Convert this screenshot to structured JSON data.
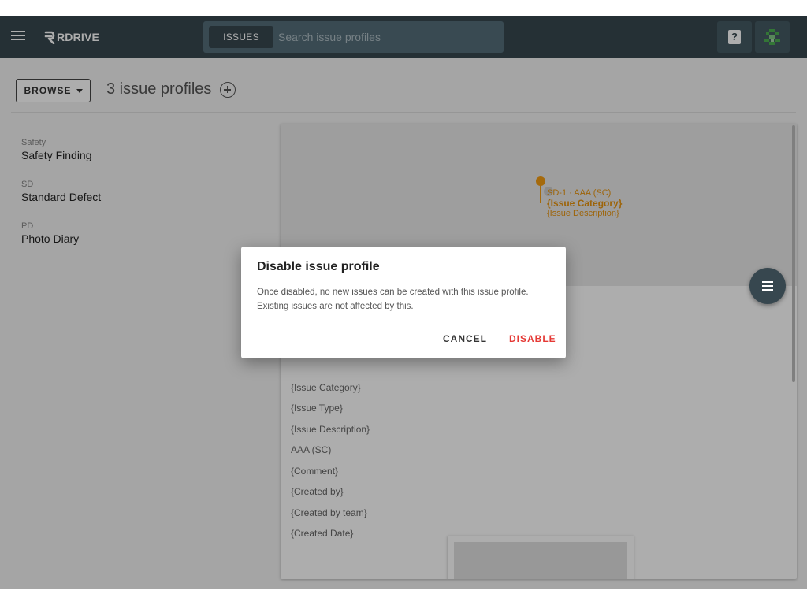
{
  "app": {
    "brand": "RDRIVE",
    "search_scope": "ISSUES",
    "search_placeholder": "Search issue profiles",
    "help_label": "?"
  },
  "header": {
    "browse_label": "BROWSE",
    "title": "3 issue profiles"
  },
  "profiles": [
    {
      "code": "Safety",
      "name": "Safety Finding"
    },
    {
      "code": "SD",
      "name": "Standard Defect"
    },
    {
      "code": "PD",
      "name": "Photo Diary"
    }
  ],
  "preview": {
    "pin_line1": "SD-1 · AAA (SC)",
    "pin_line2": "{Issue Category}",
    "pin_line3": "{Issue Description}",
    "fields": [
      "{Issue Category}",
      "{Issue Type}",
      "{Issue Description}",
      "AAA (SC)",
      "{Comment}",
      "{Created by}",
      "{Created by team}",
      "{Created Date}"
    ]
  },
  "dialog": {
    "title": "Disable issue profile",
    "body_line1": "Once disabled, no new issues can be created with this issue profile.",
    "body_line2": "Existing issues are not affected by this.",
    "cancel_label": "CANCEL",
    "disable_label": "DISABLE"
  },
  "colors": {
    "topbar": "#37474f",
    "accent_orange": "#f39c12",
    "danger": "#e53935"
  }
}
